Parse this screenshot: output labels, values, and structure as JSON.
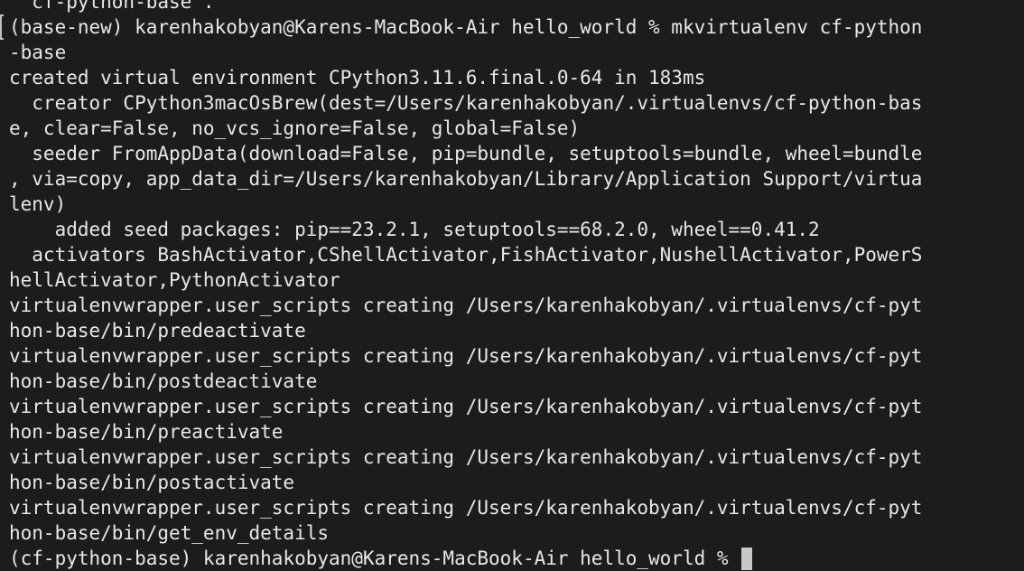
{
  "terminal": {
    "lines": [
      "  cf-python-base .",
      "(base-new) karenhakobyan@Karens-MacBook-Air hello_world % mkvirtualenv cf-python",
      "-base",
      "created virtual environment CPython3.11.6.final.0-64 in 183ms",
      "  creator CPython3macOsBrew(dest=/Users/karenhakobyan/.virtualenvs/cf-python-bas",
      "e, clear=False, no_vcs_ignore=False, global=False)",
      "  seeder FromAppData(download=False, pip=bundle, setuptools=bundle, wheel=bundle",
      ", via=copy, app_data_dir=/Users/karenhakobyan/Library/Application Support/virtua",
      "lenv)",
      "    added seed packages: pip==23.2.1, setuptools==68.2.0, wheel==0.41.2",
      "  activators BashActivator,CShellActivator,FishActivator,NushellActivator,PowerS",
      "hellActivator,PythonActivator",
      "virtualenvwrapper.user_scripts creating /Users/karenhakobyan/.virtualenvs/cf-pyt",
      "hon-base/bin/predeactivate",
      "virtualenvwrapper.user_scripts creating /Users/karenhakobyan/.virtualenvs/cf-pyt",
      "hon-base/bin/postdeactivate",
      "virtualenvwrapper.user_scripts creating /Users/karenhakobyan/.virtualenvs/cf-pyt",
      "hon-base/bin/preactivate",
      "virtualenvwrapper.user_scripts creating /Users/karenhakobyan/.virtualenvs/cf-pyt",
      "hon-base/bin/postactivate",
      "virtualenvwrapper.user_scripts creating /Users/karenhakobyan/.virtualenvs/cf-pyt",
      "hon-base/bin/get_env_details"
    ],
    "prompt": "(cf-python-base) karenhakobyan@Karens-MacBook-Air hello_world % "
  }
}
